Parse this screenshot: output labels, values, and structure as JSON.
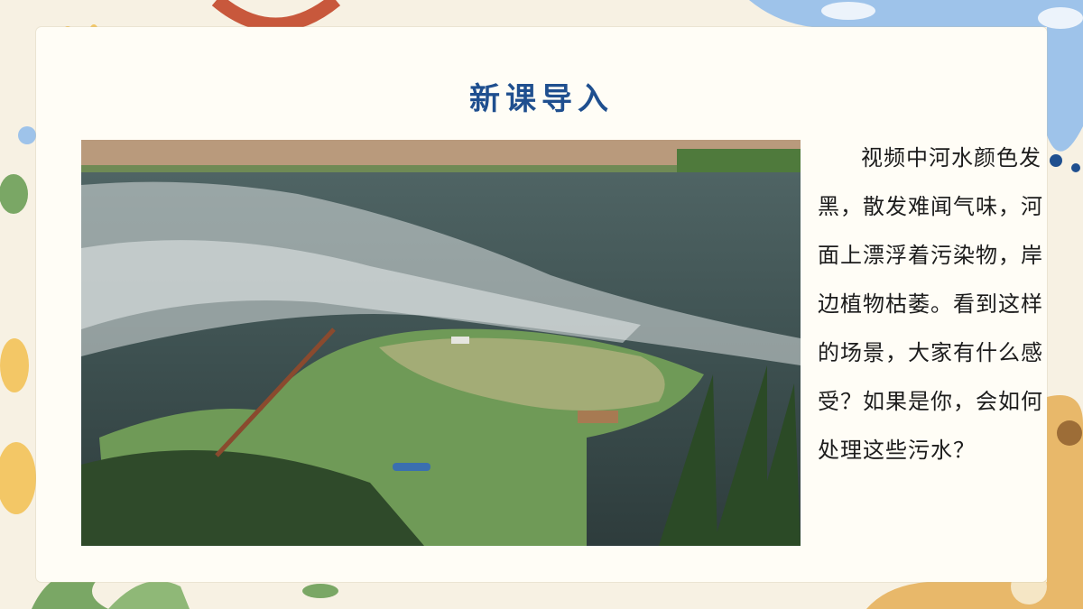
{
  "slide": {
    "title": "新课导入",
    "body": "视频中河水颜色发黑，散发难闻气味，河面上漂浮着污染物，岸边植物枯萎。看到这样的场景，大家有什么感受？如果是你，会如何处理这些污水？"
  },
  "colors": {
    "title": "#1f4f8f",
    "background": "#f7f1e3",
    "card": "#fffdf6",
    "accent_blue": "#8fb6e0",
    "accent_orange": "#f3c766",
    "accent_green": "#7aa765",
    "accent_red": "#c8583c"
  },
  "icons": {
    "top_left": "flower-icon",
    "photo": "polluted-river-photo"
  }
}
